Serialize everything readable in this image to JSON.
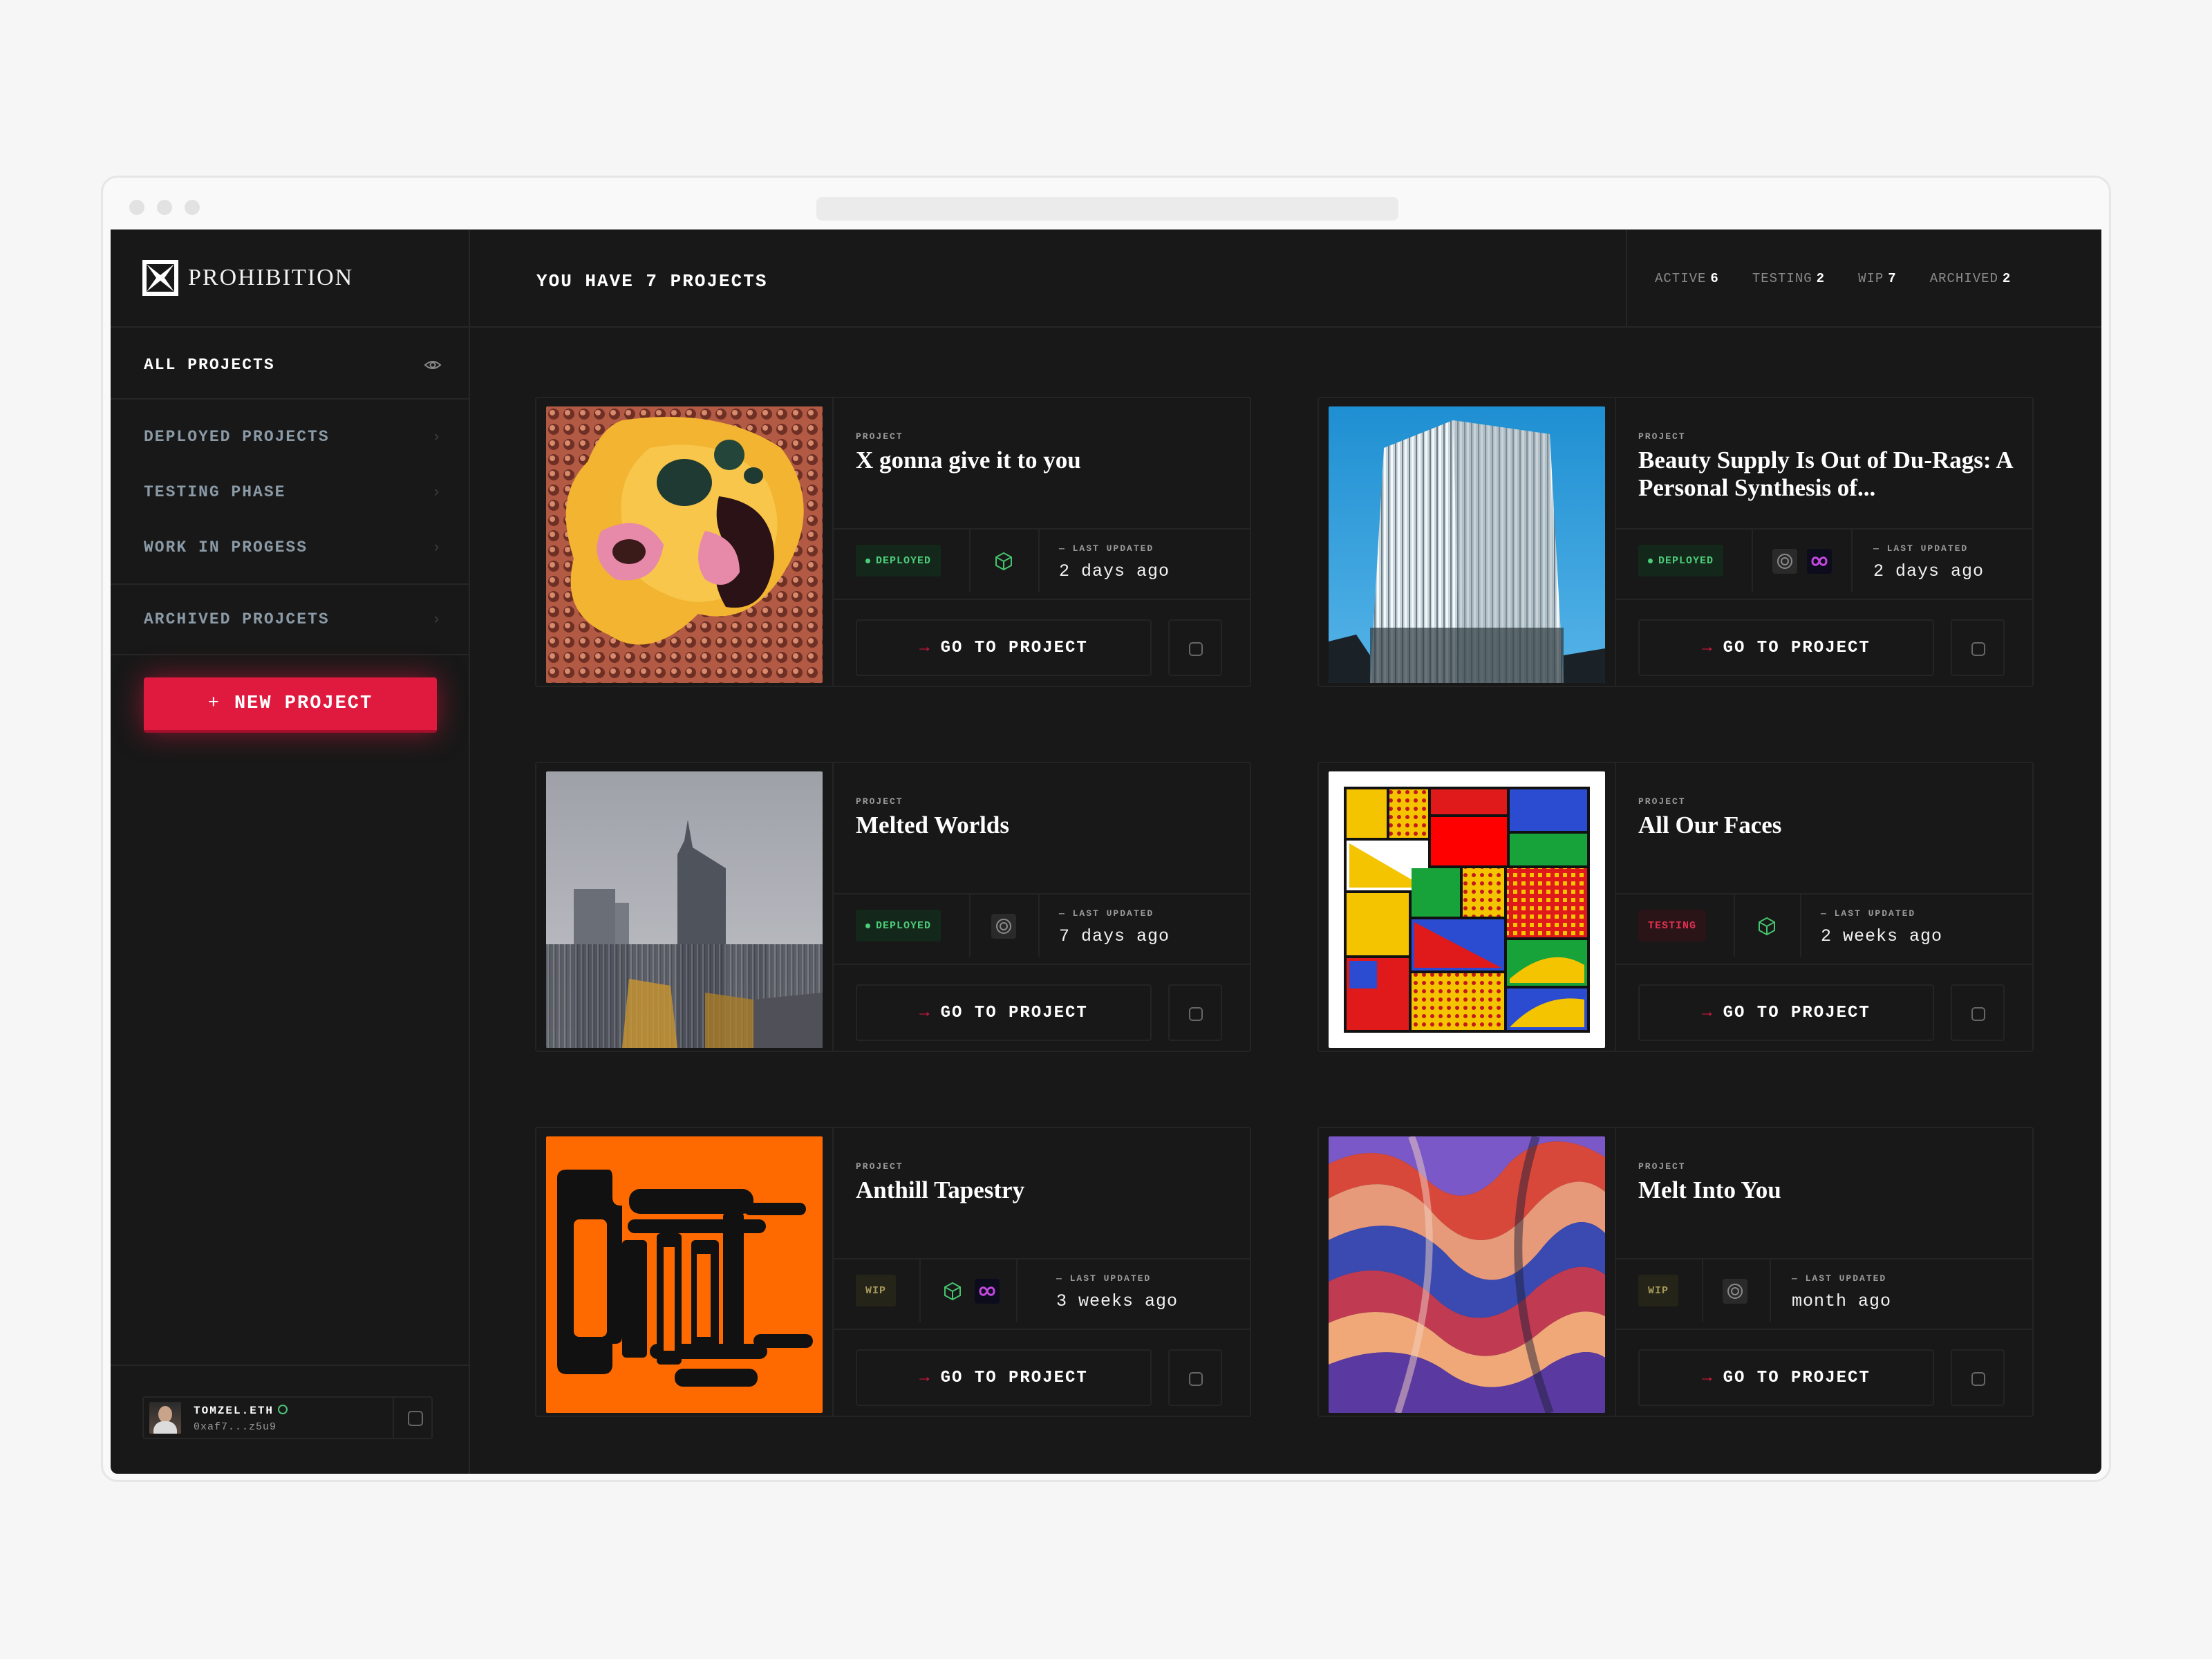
{
  "app": {
    "brand": "PROHIBITION"
  },
  "sidebar": {
    "all_projects": "ALL PROJECTS",
    "items": [
      {
        "label": "DEPLOYED PROJECTS"
      },
      {
        "label": "TESTING PHASE"
      },
      {
        "label": "WORK IN PROGESS"
      },
      {
        "label": "ARCHIVED PROJCETS"
      }
    ],
    "new_project": "NEW PROJECT",
    "user": {
      "name": "TOMZEL.ETH",
      "address": "0xaf7...z5u9"
    }
  },
  "header": {
    "title": "YOU HAVE 7 PROJECTS",
    "stats": [
      {
        "label": "ACTIVE",
        "value": "6"
      },
      {
        "label": "TESTING",
        "value": "2"
      },
      {
        "label": "WIP",
        "value": "7"
      },
      {
        "label": "ARCHIVED",
        "value": "2"
      }
    ]
  },
  "common": {
    "project_label": "PROJECT",
    "last_updated_label": "— LAST UPDATED",
    "go_to_project": "GO TO PROJECT"
  },
  "projects": [
    {
      "title": "X gonna give it to you",
      "status": "DEPLOYED",
      "chains": [
        "cube-icon"
      ],
      "last_updated": "2 days ago"
    },
    {
      "title": "Beauty Supply Is Out of Du-Rags: A Personal Synthesis of...",
      "status": "DEPLOYED",
      "chains": [
        "ring-icon",
        "infinity-icon"
      ],
      "last_updated": "2 days ago"
    },
    {
      "title": "Melted Worlds",
      "status": "DEPLOYED",
      "chains": [
        "ring-icon"
      ],
      "last_updated": "7 days ago"
    },
    {
      "title": "All Our Faces",
      "status": "TESTING",
      "chains": [
        "cube-icon"
      ],
      "last_updated": "2 weeks ago"
    },
    {
      "title": "Anthill Tapestry",
      "status": "WIP",
      "chains": [
        "cube-icon",
        "infinity-icon"
      ],
      "last_updated": "3 weeks ago"
    },
    {
      "title": "Melt Into You",
      "status": "WIP",
      "chains": [
        "ring-icon"
      ],
      "last_updated": "month ago"
    }
  ],
  "colors": {
    "accent": "#e0193f",
    "deployed": "#4ccd7a",
    "testing": "#e0304f",
    "wip": "#a59a5c",
    "background": "#181818"
  }
}
